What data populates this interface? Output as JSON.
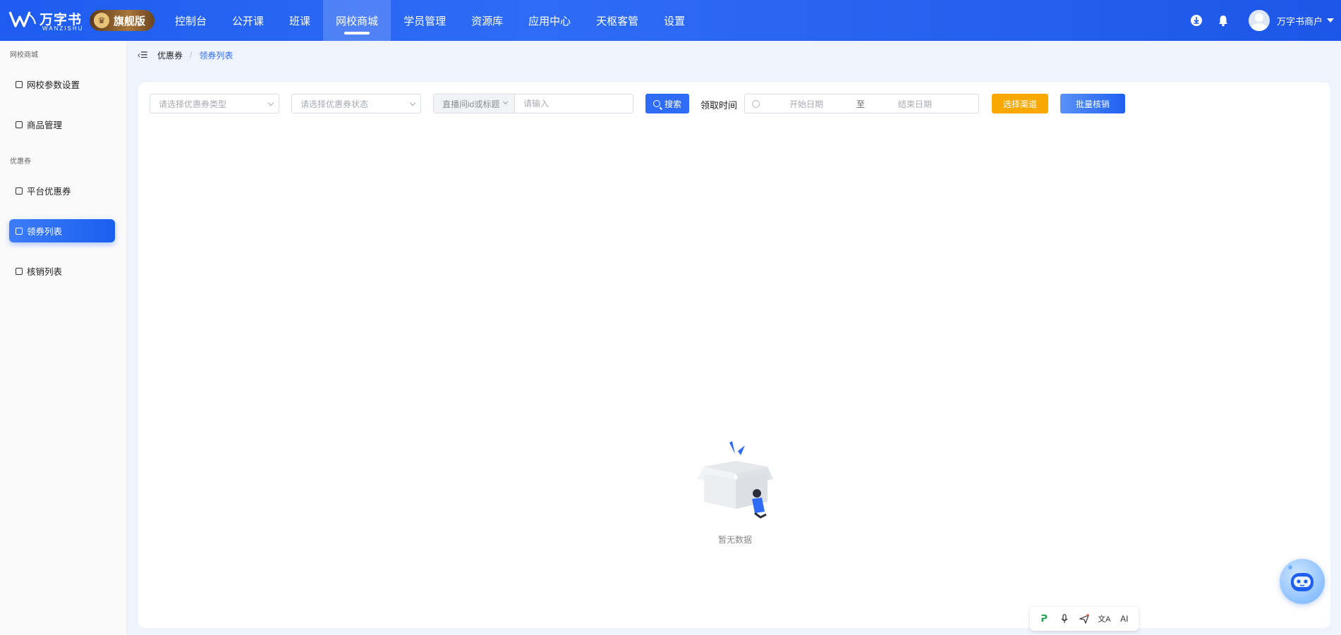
{
  "header": {
    "brand": "万字书",
    "brand_sub": "WANZISHU",
    "edition": "旗舰版",
    "nav": [
      "控制台",
      "公开课",
      "班课",
      "网校商城",
      "学员管理",
      "资源库",
      "应用中心",
      "天枢客管",
      "设置"
    ],
    "active_nav": "网校商城",
    "user_name": "万字书商户"
  },
  "sidebar": {
    "group1": "网校商城",
    "items1": [
      "网校参数设置",
      "商品管理"
    ],
    "group2": "优惠券",
    "items2": [
      "平台优惠券",
      "领券列表",
      "核销列表"
    ],
    "active_item": "领券列表"
  },
  "breadcrumb": {
    "parent": "优惠券",
    "sep": "/",
    "current": "领券列表"
  },
  "filters": {
    "type_placeholder": "请选择优惠券类型",
    "status_placeholder": "请选择优惠券状态",
    "combo_prefix": "直播间id或标题",
    "combo_placeholder": "请输入",
    "search_label": "搜索",
    "time_label": "领取时间",
    "start_placeholder": "开始日期",
    "range_sep": "至",
    "end_placeholder": "结束日期",
    "channel_label": "选择渠道",
    "verify_label": "批量核销"
  },
  "empty_text": "暂无数据",
  "colors": {
    "primary": "#2f6cf5",
    "warning": "#f8a800"
  }
}
